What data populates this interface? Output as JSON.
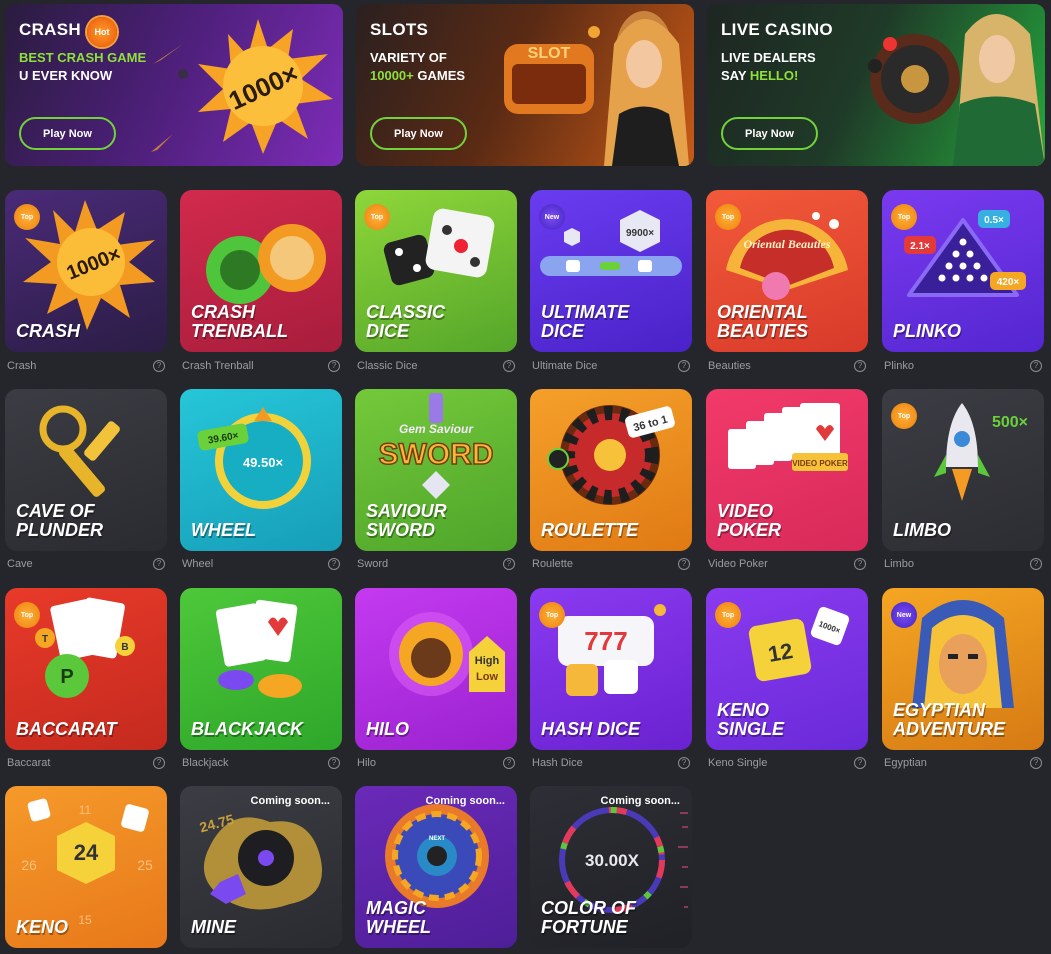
{
  "banners": [
    {
      "title": "CRASH",
      "badge": "Hot",
      "line1": "BEST CRASH GAME",
      "line2": "U EVER KNOW",
      "art_text": "1000×",
      "button": "Play Now"
    },
    {
      "title": "SLOTS",
      "line1_a": "VARIETY OF",
      "line2_a": "10000+",
      "line2_b": " GAMES",
      "art_text": "SLOT",
      "button": "Play Now"
    },
    {
      "title": "LIVE CASINO",
      "line1_a": "LIVE DEALERS",
      "line2_a": "SAY ",
      "line2_b": "HELLO!",
      "button": "Play Now"
    }
  ],
  "tags": {
    "top": "Top",
    "new": "New",
    "coming": "Coming soon..."
  },
  "tiles": [
    {
      "name": "CRASH",
      "caption": "Crash",
      "art_text": "1000×"
    },
    {
      "name": "CRASH\nTRENBALL",
      "caption": "Crash Trenball"
    },
    {
      "name": "CLASSIC\nDICE",
      "caption": "Classic Dice"
    },
    {
      "name": "ULTIMATE\nDICE",
      "caption": "Ultimate Dice",
      "art_text": "9900×"
    },
    {
      "name": "ORIENTAL\nBEAUTIES",
      "caption": "Beauties",
      "art_text": "Oriental Beauties"
    },
    {
      "name": "PLINKO",
      "caption": "Plinko",
      "art_a": "2.1×",
      "art_b": "0.5×",
      "art_c": "420×"
    },
    {
      "name": "CAVE OF\nPLUNDER",
      "caption": "Cave"
    },
    {
      "name": "WHEEL",
      "caption": "Wheel",
      "art_a": "39.60×",
      "art_b": "49.50×"
    },
    {
      "name": "SAVIOUR\nSWORD",
      "caption": "Sword",
      "art_a": "Gem Saviour",
      "art_b": "SWORD"
    },
    {
      "name": "ROULETTE",
      "caption": "Roulette",
      "art_text": "36 to 1"
    },
    {
      "name": "VIDEO\nPOKER",
      "caption": "Video Poker",
      "art_text": "VIDEO POKER"
    },
    {
      "name": "LIMBO",
      "caption": "Limbo",
      "art_text": "500×"
    },
    {
      "name": "BACCARAT",
      "caption": "Baccarat",
      "art_a": "T",
      "art_b": "B",
      "art_c": "P"
    },
    {
      "name": "BLACKJACK",
      "caption": "Blackjack"
    },
    {
      "name": "HILO",
      "caption": "Hilo",
      "art_a": "High",
      "art_b": "Low"
    },
    {
      "name": "HASH DICE",
      "caption": "Hash Dice",
      "art_text": "777"
    },
    {
      "name": "KENO\nSINGLE",
      "caption": "Keno Single",
      "art_a": "12",
      "art_b": "1000×"
    },
    {
      "name": "EGYPTIAN\nADVENTURE",
      "caption": "Egyptian"
    },
    {
      "name": "KENO",
      "art_a": "24",
      "art_b": "26",
      "art_c": "25",
      "art_d": "15",
      "art_e": "11"
    },
    {
      "name": "MINE",
      "art_text": "24.75"
    },
    {
      "name": "MAGIC\nWHEEL",
      "art_text": "NEXT"
    },
    {
      "name": "COLOR OF\nFORTUNE",
      "art_text": "30.00X"
    }
  ],
  "colors": {
    "background": "#24262b",
    "accent_green": "#8ee03b",
    "caption": "#9a9ca3"
  },
  "icons": [
    "help-icon",
    "hot-badge",
    "top-badge",
    "new-badge"
  ]
}
